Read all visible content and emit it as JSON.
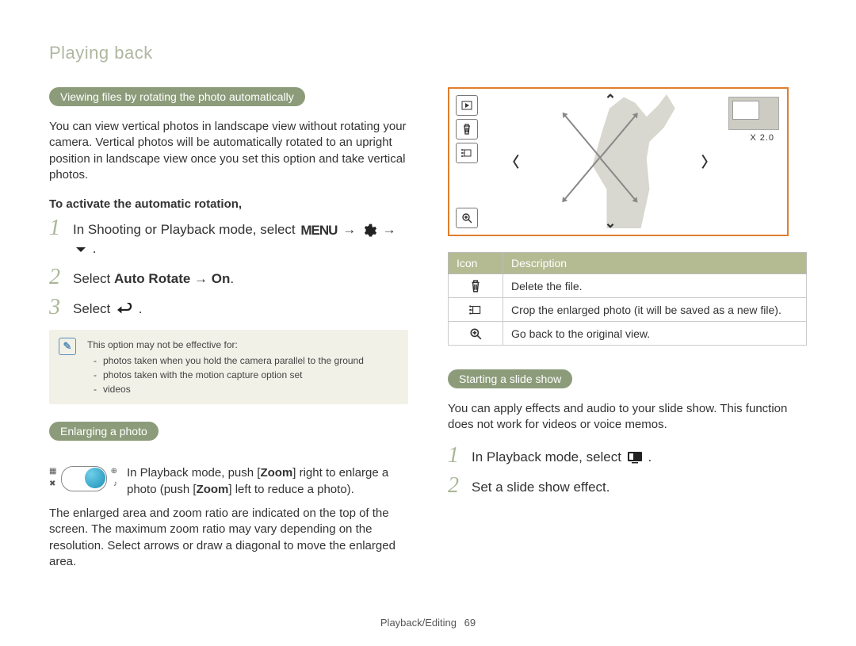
{
  "pageTitle": "Playing back",
  "left": {
    "pill1": "Viewing files by rotating the photo automatically",
    "intro": "You can view vertical photos in landscape view without rotating your camera. Vertical photos will be automatically rotated to an upright position in landscape view once you set this option and take vertical photos.",
    "subhead1": "To activate the automatic rotation,",
    "step1a": "In Shooting or Playback mode, select ",
    "step1b": " → ",
    "step1c": " → ",
    "step1d": ".",
    "step2a": "Select ",
    "step2b": "Auto Rotate",
    "step2c": " → ",
    "step2d": "On",
    "step2e": ".",
    "step3a": "Select ",
    "step3b": ".",
    "noteTitle": "This option may not be effective for:",
    "noteItems": [
      "photos taken when you hold the camera parallel to the ground",
      "photos taken with the motion capture option set",
      "videos"
    ],
    "pill2": "Enlarging a photo",
    "zoomTextA": "In Playback mode, push [",
    "zoomTextB": "Zoom",
    "zoomTextC": "] right to enlarge a photo (push [",
    "zoomTextD": "Zoom",
    "zoomTextE": "] left to reduce a photo).",
    "para2": "The enlarged area and zoom ratio are indicated on the top of the screen. The maximum zoom ratio may vary depending on the resolution. Select arrows or draw a diagonal to move the enlarged area."
  },
  "right": {
    "zoomLabel": "X 2.0",
    "tableHead": {
      "col1": "Icon",
      "col2": "Description"
    },
    "rows": [
      {
        "desc": "Delete the file."
      },
      {
        "desc": "Crop the enlarged photo (it will be saved as a new file)."
      },
      {
        "desc": "Go back to the original view."
      }
    ],
    "pill3": "Starting a slide show",
    "slideIntro": "You can apply effects and audio to your slide show. This function does not work for videos or voice memos.",
    "sstep1a": "In Playback mode, select ",
    "sstep1b": ".",
    "sstep2": "Set a slide show effect."
  },
  "footer": {
    "section": "Playback/Editing",
    "page": "69"
  }
}
